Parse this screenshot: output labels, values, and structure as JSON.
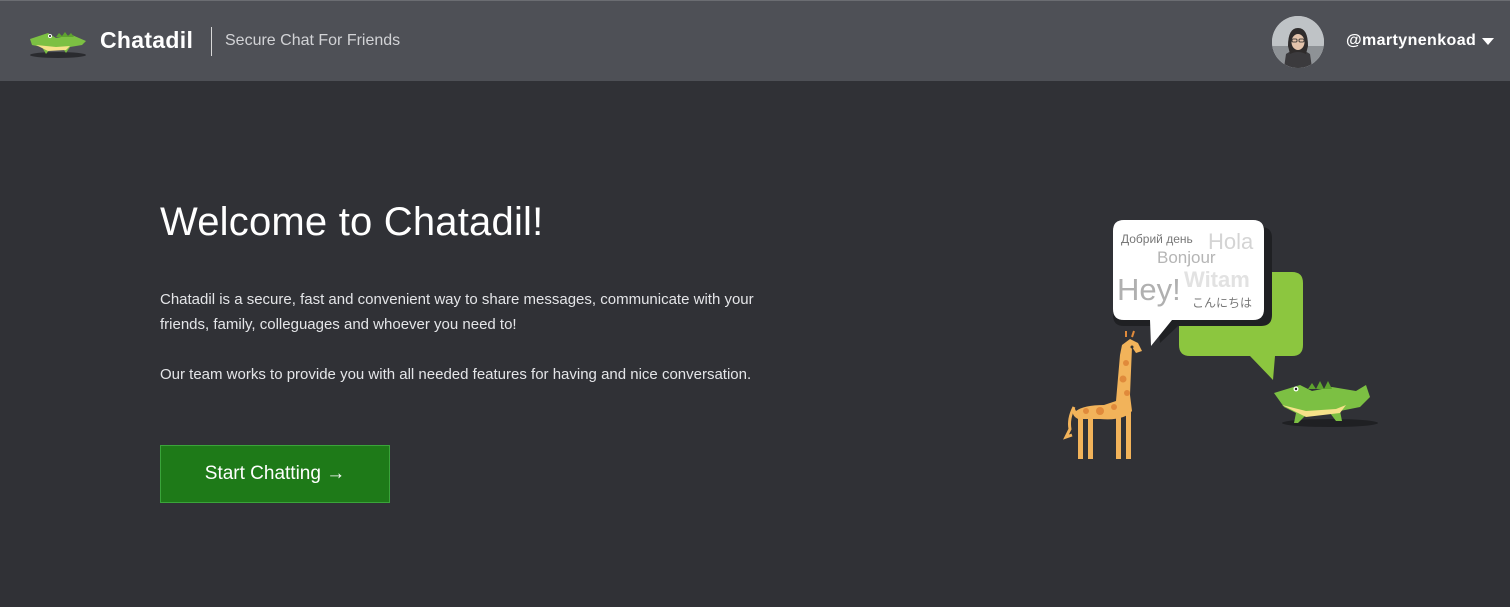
{
  "header": {
    "brand_name": "Chatadil",
    "tagline": "Secure Chat For Friends",
    "username": "@martynenkoad",
    "logo_icon": "crocodile-logo-icon",
    "avatar_icon": "user-avatar",
    "caret_icon": "caret-down-icon"
  },
  "main": {
    "title": "Welcome to Chatadil!",
    "paragraph_1": "Chatadil is a secure, fast and convenient way to share messages, communicate with your friends, family, colleguages and whoever you need to!",
    "paragraph_2": "Our team works to provide you with all needed features for having and nice conversation.",
    "start_button_label": "Start Chatting →"
  },
  "illustration": {
    "greetings": {
      "ukrainian": "Добрий день",
      "spanish": "Hola",
      "french": "Bonjour",
      "english": "Hey!",
      "polish": "Witam",
      "japanese": "こんにちは"
    }
  },
  "colors": {
    "background": "#303136",
    "header": "#4e5056",
    "accent_green": "#1e7a18",
    "bubble_green": "#8cc63f",
    "giraffe": "#f2b35a"
  }
}
